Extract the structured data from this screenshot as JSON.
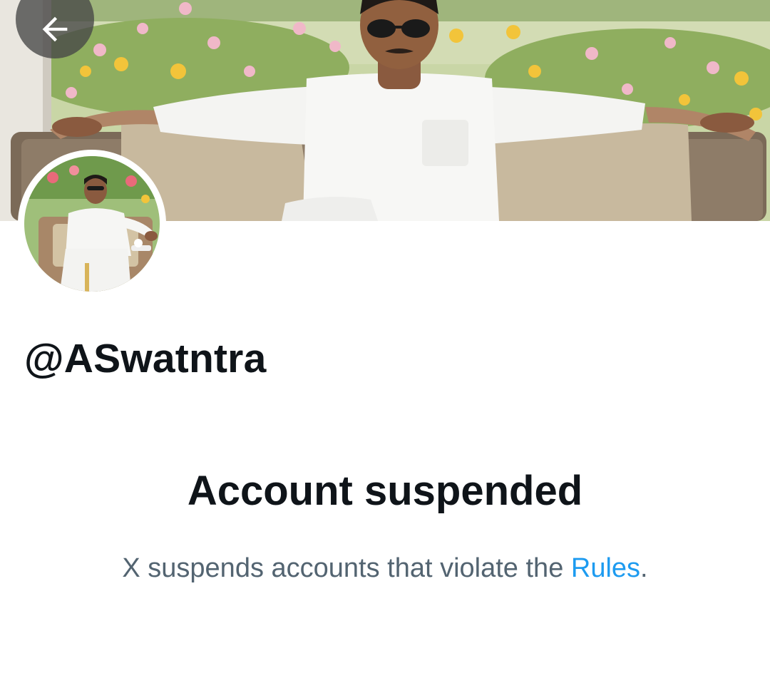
{
  "profile": {
    "handle": "@ASwatntra"
  },
  "suspension": {
    "title": "Account suspended",
    "message_prefix": "X suspends accounts that violate the ",
    "rules_link": "Rules",
    "message_suffix": "."
  },
  "icons": {
    "back": "arrow-left-icon"
  },
  "colors": {
    "text_primary": "#0f1419",
    "text_secondary": "#536471",
    "link": "#1d9bf0",
    "background": "#ffffff"
  }
}
